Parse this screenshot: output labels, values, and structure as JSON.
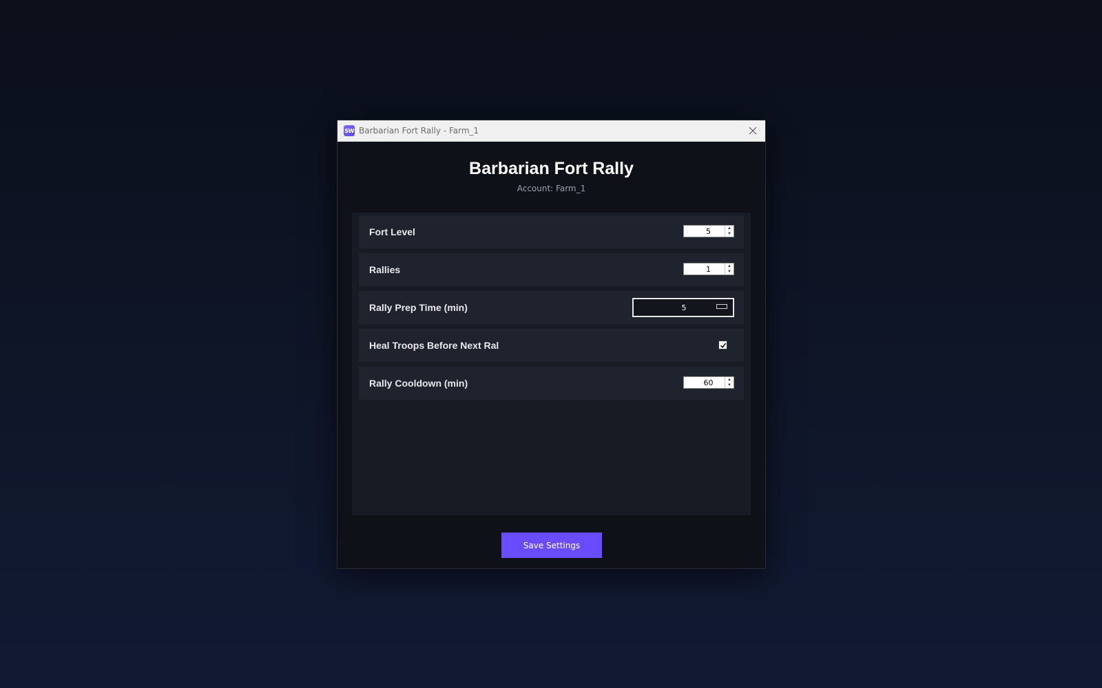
{
  "window": {
    "title": "Barbarian Fort Rally - Farm_1",
    "app_icon_text": "SW",
    "icons": {
      "app": "app-logo-icon",
      "close": "close-icon",
      "spin_up": "arrow-up-icon",
      "spin_down": "arrow-down-icon",
      "check": "checkmark-icon"
    }
  },
  "header": {
    "title": "Barbarian Fort Rally",
    "account": "Account: Farm_1"
  },
  "settings": {
    "fort_level": {
      "label": "Fort Level",
      "value": "5"
    },
    "rallies": {
      "label": "Rallies",
      "value": "1"
    },
    "rally_prep_time": {
      "label": "Rally Prep Time (min)",
      "value": "5"
    },
    "heal_troops": {
      "label": "Heal Troops Before Next Ral",
      "checked": true
    },
    "rally_cooldown": {
      "label": "Rally Cooldown (min)",
      "value": "60"
    }
  },
  "actions": {
    "save_label": "Save Settings"
  },
  "colors": {
    "background_top": "#0b0f1a",
    "background_bottom": "#111a33",
    "window_bg": "#0f1118",
    "panel_bg": "#171b24",
    "row_bg": "#1e232e",
    "accent": "#6a4cff",
    "titlebar_bg": "#f0f0f0"
  }
}
